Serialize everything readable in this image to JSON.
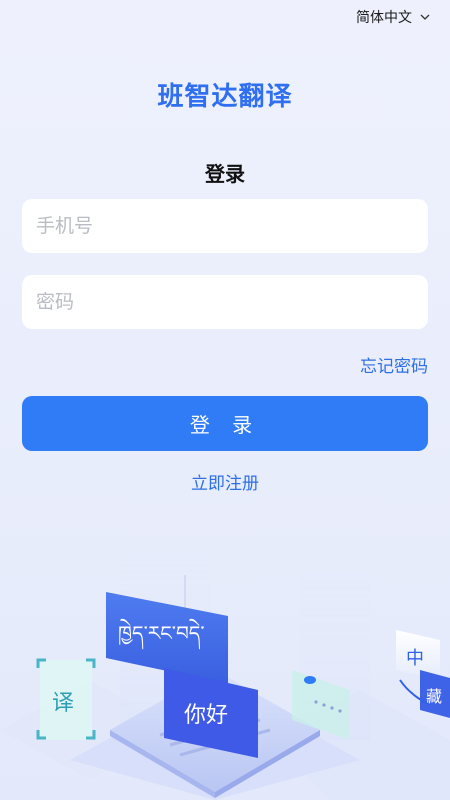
{
  "header": {
    "language": "简体中文",
    "language_icon": "chevron-down-icon"
  },
  "app": {
    "title": "班智达翻译"
  },
  "login": {
    "heading": "登录",
    "phone_placeholder": "手机号",
    "password_placeholder": "密码",
    "forgot_password": "忘记密码",
    "submit_label": "登 录",
    "register_link": "立即注册"
  },
  "illustration": {
    "tibetan_text": "ཁྱེད་རང་བདེ་",
    "chinese_text": "你好",
    "translate_char": "译",
    "tile_char_1": "中",
    "tile_char_2": "藏"
  },
  "colors": {
    "accent": "#2f7cf6",
    "title": "#2f6ff0",
    "link": "#2d6fe6",
    "background": "#eaeefc"
  }
}
